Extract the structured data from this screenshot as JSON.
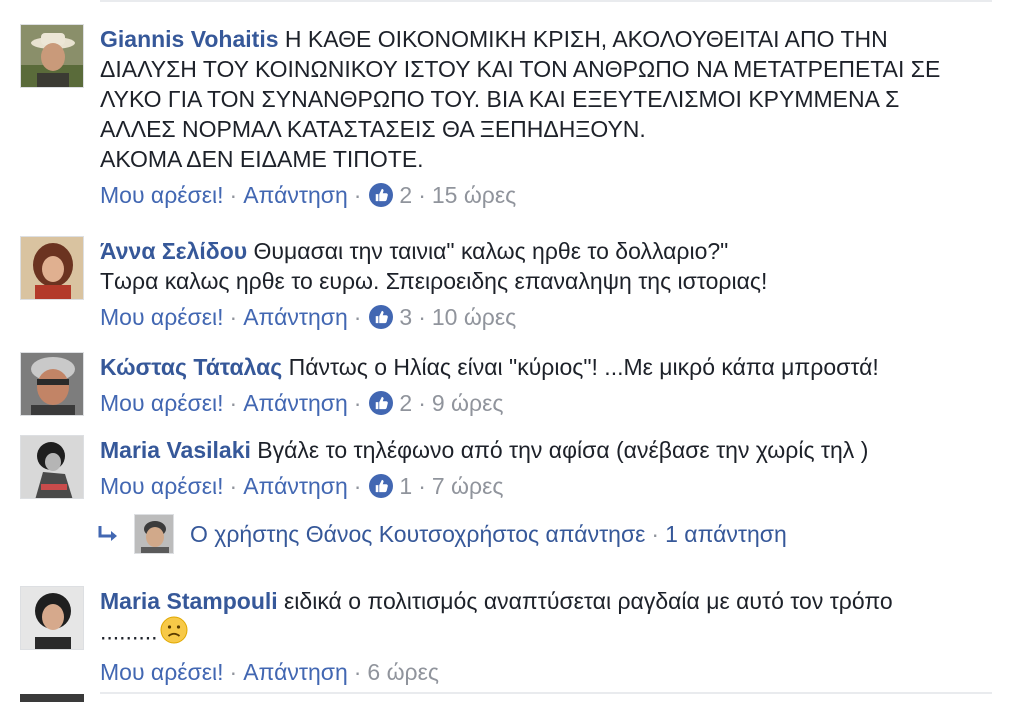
{
  "comments": [
    {
      "author": "Giannis Vohaitis",
      "text": "Η ΚΑΘΕ ΟΙΚΟΝΟΜΙΚΗ ΚΡΙΣΗ, ΑΚΟΛΟΥΘΕΙΤΑΙ ΑΠΟ ΤΗΝ\nΔΙΑΛΥΣΗ ΤΟΥ ΚΟΙΝΩΝΙΚΟΥ ΙΣΤΟΥ ΚΑΙ ΤΟΝ ΑΝΘΡΩΠΟ ΝΑ ΜΕΤΑΤΡΕΠΕΤΑΙ ΣΕ\nΛΥΚΟ ΓΙΑ ΤΟΝ ΣΥΝΑΝΘΡΩΠΟ ΤΟΥ. ΒΙΑ ΚΑΙ ΕΞΕΥΤΕΛΙΣΜΟΙ ΚΡΥΜΜΕΝΑ Σ\nΑΛΛΕΣ ΝΟΡΜΑΛ ΚΑΤΑΣΤΑΣΕΙΣ ΘΑ ΞΕΠΗΔΗΞΟΥΝ.\nΑΚΟΜΑ ΔΕΝ ΕΙΔΑΜΕ ΤΙΠΟΤΕ.",
      "like_label": "Μου αρέσει!",
      "reply_label": "Απάντηση",
      "likes": "2",
      "time": "15 ώρες"
    },
    {
      "author": "Άννα Σελίδου",
      "text": "Θυμασαι την ταινια\" καλως ηρθε το δολλαριο?\"\nΤωρα καλως ηρθε το ευρω. Σπειροειδης επαναληψη της ιστοριας!",
      "like_label": "Μου αρέσει!",
      "reply_label": "Απάντηση",
      "likes": "3",
      "time": "10 ώρες"
    },
    {
      "author": "Κώστας Τάταλας",
      "text": "Πάντως ο Ηλίας είναι \"κύριος\"! ...Με μικρό κάπα μπροστά!",
      "like_label": "Μου αρέσει!",
      "reply_label": "Απάντηση",
      "likes": "2",
      "time": "9 ώρες"
    },
    {
      "author": "Maria Vasilaki",
      "text": "Βγάλε το τηλέφωνο από την αφίσα (ανέβασε την χωρίς τηλ )",
      "like_label": "Μου αρέσει!",
      "reply_label": "Απάντηση",
      "likes": "1",
      "time": "7 ώρες"
    },
    {
      "author": "Maria Stampouli",
      "text": "ειδικά ο πολιτισμός αναπτύσεται ραγδαία με αυτό τον τρόπο\n.........",
      "like_label": "Μου αρέσει!",
      "reply_label": "Απάντηση",
      "time": "6 ώρες"
    }
  ],
  "reply_thread": {
    "text": "Ο χρήστης Θάνος Κουτσοχρήστος απάντησε",
    "count": "1 απάντηση"
  },
  "colors": {
    "link": "#365899",
    "action": "#4267b2",
    "muted": "#90949c",
    "like_badge": "#4267b2"
  }
}
